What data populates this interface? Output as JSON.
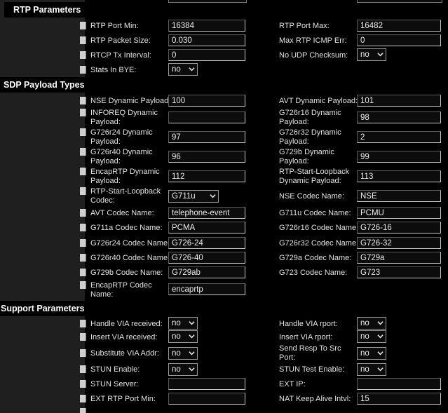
{
  "sections": {
    "rtp": "RTP Parameters",
    "sdp": "SDP Payload Types",
    "support": "Support Parameters"
  },
  "rtp": {
    "port_min": {
      "label": "RTP Port Min:",
      "value": "16384"
    },
    "port_max": {
      "label": "RTP Port Max:",
      "value": "16482"
    },
    "packet_size": {
      "label": "RTP Packet Size:",
      "value": "0.030"
    },
    "max_icmp_err": {
      "label": "Max RTP ICMP Err:",
      "value": "0"
    },
    "rtcp_tx_interval": {
      "label": "RTCP Tx Interval:",
      "value": "0"
    },
    "no_udp_checksum": {
      "label": "No UDP Checksum:",
      "value": "no"
    },
    "stats_in_bye": {
      "label": "Stats In BYE:",
      "value": "no"
    }
  },
  "sdp": {
    "nse_dyn": {
      "label": "NSE Dynamic Payload:",
      "value": "100"
    },
    "avt_dyn": {
      "label": "AVT Dynamic Payload:",
      "value": "101"
    },
    "inforeq_dyn": {
      "label1": "INFOREQ Dynamic",
      "label2": "Payload:",
      "value": ""
    },
    "g726r16_dyn": {
      "label1": "G726r16 Dynamic",
      "label2": "Payload:",
      "value": "98"
    },
    "g726r24_dyn": {
      "label1": "G726r24 Dynamic",
      "label2": "Payload:",
      "value": "97"
    },
    "g726r32_dyn": {
      "label1": "G726r32 Dynamic",
      "label2": "Payload:",
      "value": "2"
    },
    "g726r40_dyn": {
      "label1": "G726r40 Dynamic",
      "label2": "Payload:",
      "value": "96"
    },
    "g729b_dyn": {
      "label1": "G729b Dynamic",
      "label2": "Payload:",
      "value": "99"
    },
    "encaprtp_dyn": {
      "label1": "EncapRTP Dynamic",
      "label2": "Payload:",
      "value": "112"
    },
    "rtp_loopback_dyn": {
      "label1": "RTP-Start-Loopback",
      "label2": "Dynamic Payload:",
      "value": "113"
    },
    "rtp_loopback_codec": {
      "label1": "RTP-Start-Loopback",
      "label2": "Codec:",
      "value": "G711u"
    },
    "nse_codec": {
      "label": "NSE Codec Name:",
      "value": "NSE"
    },
    "avt_codec": {
      "label": "AVT Codec Name:",
      "value": "telephone-event"
    },
    "g711u_codec": {
      "label": "G711u Codec Name:",
      "value": "PCMU"
    },
    "g711a_codec": {
      "label": "G711a Codec Name:",
      "value": "PCMA"
    },
    "g726r16_codec": {
      "label": "G726r16 Codec Name:",
      "value": "G726-16"
    },
    "g726r24_codec": {
      "label": "G726r24 Codec Name:",
      "value": "G726-24"
    },
    "g726r32_codec": {
      "label": "G726r32 Codec Name:",
      "value": "G726-32"
    },
    "g726r40_codec": {
      "label": "G726r40 Codec Name:",
      "value": "G726-40"
    },
    "g729a_codec": {
      "label": "G729a Codec Name:",
      "value": "G729a"
    },
    "g729b_codec": {
      "label": "G729b Codec Name:",
      "value": "G729ab"
    },
    "g723_codec": {
      "label": "G723 Codec Name:",
      "value": "G723"
    },
    "encaprtp_codec": {
      "label1": "EncapRTP Codec",
      "label2": "Name:",
      "value": "encaprtp"
    }
  },
  "support": {
    "handle_via_received": {
      "label": "Handle VIA received:",
      "value": "no"
    },
    "handle_via_rport": {
      "label": "Handle VIA rport:",
      "value": "no"
    },
    "insert_via_received": {
      "label": "Insert VIA received:",
      "value": "no"
    },
    "insert_via_rport": {
      "label": "Insert VIA rport:",
      "value": "no"
    },
    "substitute_via_addr": {
      "label": "Substitute VIA Addr:",
      "value": "no"
    },
    "send_resp_src_port": {
      "label1": "Send Resp To Src",
      "label2": "Port:",
      "value": "no"
    },
    "stun_enable": {
      "label": "STUN Enable:",
      "value": "no"
    },
    "stun_test_enable": {
      "label": "STUN Test Enable:",
      "value": "no"
    },
    "stun_server": {
      "label": "STUN Server:",
      "value": ""
    },
    "ext_ip": {
      "label": "EXT IP:",
      "value": ""
    },
    "ext_rtp_port_min": {
      "label": "EXT RTP Port Min:",
      "value": ""
    },
    "nat_keep_alive": {
      "label": "NAT Keep Alive Intvl:",
      "value": "15"
    }
  }
}
